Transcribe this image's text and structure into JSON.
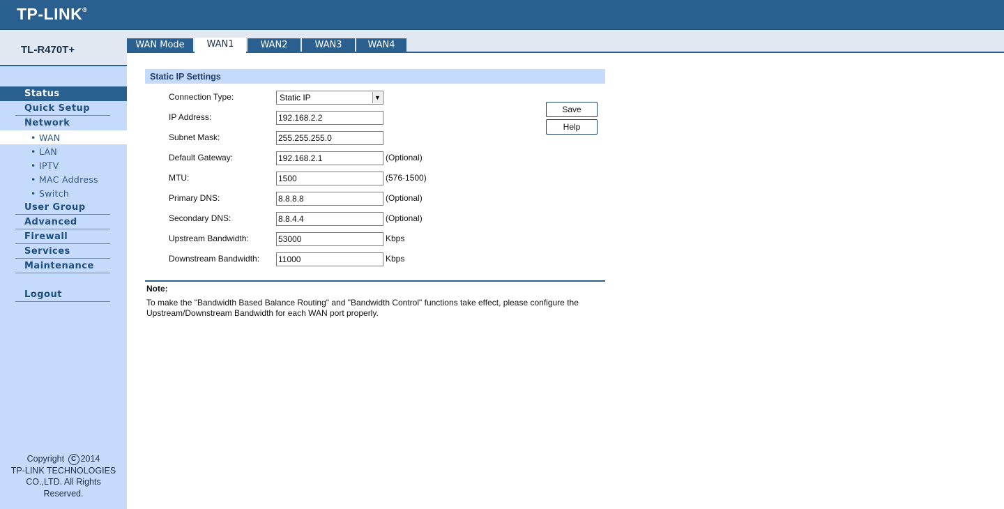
{
  "header": {
    "brand": "TP-LINK",
    "brand_mark": "®"
  },
  "model": "TL-R470T+",
  "nav": {
    "status": "Status",
    "quick_setup": "Quick Setup",
    "network": "Network",
    "sub": {
      "wan": "WAN",
      "lan": "LAN",
      "iptv": "IPTV",
      "mac_address": "MAC Address",
      "switch": "Switch"
    },
    "user_group": "User Group",
    "advanced": "Advanced",
    "firewall": "Firewall",
    "services": "Services",
    "maintenance": "Maintenance",
    "logout": "Logout",
    "sub_bullet": "•"
  },
  "copyright": {
    "line1_pre": "Copyright",
    "symbol": "C",
    "line1_post": "2014",
    "line2": "TP-LINK TECHNOLOGIES",
    "line3": "CO.,LTD. All Rights",
    "line4": "Reserved."
  },
  "tabs": {
    "wan_mode": "WAN Mode",
    "wan1": "WAN1",
    "wan2": "WAN2",
    "wan3": "WAN3",
    "wan4": "WAN4"
  },
  "section": {
    "title": "Static IP Settings"
  },
  "form": {
    "connection_type": {
      "label": "Connection Type:",
      "value": "Static IP"
    },
    "ip_address": {
      "label": "IP Address:",
      "value": "192.168.2.2"
    },
    "subnet_mask": {
      "label": "Subnet Mask:",
      "value": "255.255.255.0"
    },
    "default_gateway": {
      "label": "Default Gateway:",
      "value": "192.168.2.1",
      "hint": "(Optional)"
    },
    "mtu": {
      "label": "MTU:",
      "value": "1500",
      "hint": "(576-1500)"
    },
    "primary_dns": {
      "label": "Primary DNS:",
      "value": "8.8.8.8",
      "hint": "(Optional)"
    },
    "secondary_dns": {
      "label": "Secondary DNS:",
      "value": "8.8.4.4",
      "hint": "(Optional)"
    },
    "upstream": {
      "label": "Upstream Bandwidth:",
      "value": "53000",
      "hint": "Kbps"
    },
    "downstream": {
      "label": "Downstream Bandwidth:",
      "value": "11000",
      "hint": "Kbps"
    }
  },
  "buttons": {
    "save": "Save",
    "help": "Help"
  },
  "note": {
    "title": "Note:",
    "text": "To make the \"Bandwidth Based Balance Routing\" and \"Bandwidth Control\" functions take effect, please configure the Upstream/Downstream Bandwidth for each WAN port properly."
  },
  "colors": {
    "header": "#29608f",
    "sidebar": "#c6dafb",
    "tab": "#29608f"
  }
}
